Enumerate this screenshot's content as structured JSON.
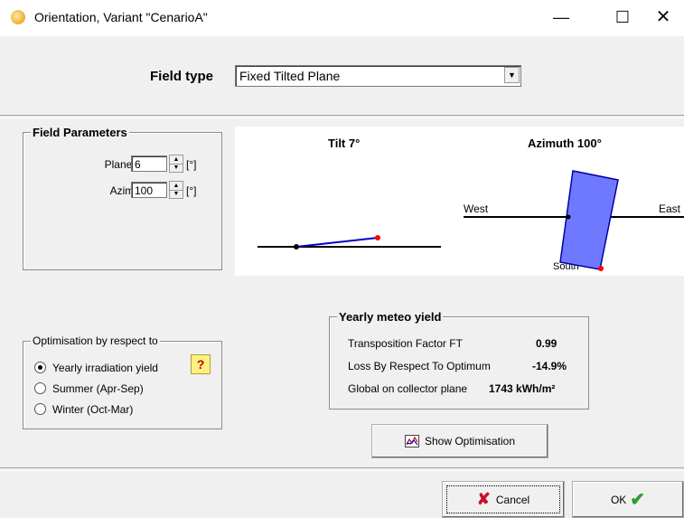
{
  "window": {
    "title": "Orientation, Variant \"CenarioA\"",
    "minimize": "—",
    "maximize": "☐",
    "close": "✕"
  },
  "field_type": {
    "label": "Field type",
    "value": "Fixed Tilted Plane",
    "arrow": "▼"
  },
  "field_parameters": {
    "title": "Field Parameters",
    "plane_tilt": {
      "label": "Plane Tilt",
      "value": "6",
      "unit": "[°]"
    },
    "azimuth": {
      "label": "Azimuth",
      "value": "100",
      "unit": "[°]"
    },
    "spin_up": "▲",
    "spin_down": "▼"
  },
  "diagram": {
    "tilt_title": "Tilt 7°",
    "azimuth_title": "Azimuth 100°",
    "west": "West",
    "east": "East",
    "south": "South"
  },
  "optimisation": {
    "title": "Optimisation by respect to",
    "options": [
      {
        "label": "Yearly irradiation yield",
        "checked": true
      },
      {
        "label": "Summer (Apr-Sep)",
        "checked": false
      },
      {
        "label": "Winter (Oct-Mar)",
        "checked": false
      }
    ],
    "help": "?"
  },
  "yearly_meteo_yield": {
    "title": "Yearly meteo yield",
    "rows": [
      {
        "label": "Transposition Factor FT",
        "value": "0.99"
      },
      {
        "label": "Loss By Respect To Optimum",
        "value": "-14.9%"
      },
      {
        "label": "Global on collector plane",
        "value": "1743 kWh/m²"
      }
    ]
  },
  "buttons": {
    "show_optimisation": "Show Optimisation",
    "cancel": "Cancel",
    "ok": "OK"
  },
  "colors": {
    "panel_fill": "#6f79ff",
    "panel_stroke": "#0000a8",
    "marker": "#ff0000",
    "check": "#2e9e2e",
    "cancel_x": "#c8102e"
  }
}
